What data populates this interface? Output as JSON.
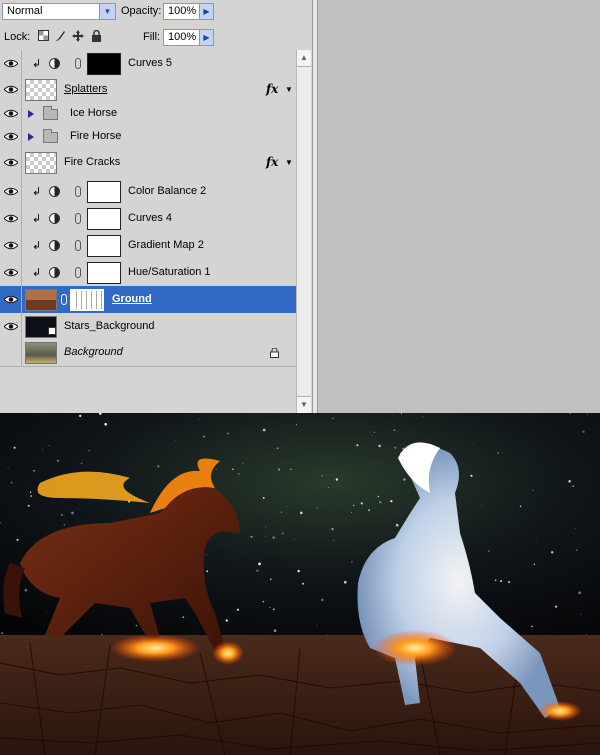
{
  "options": {
    "blend_mode": "Normal",
    "opacity_label": "Opacity:",
    "opacity_value": "100%",
    "lock_label": "Lock:",
    "fill_label": "Fill:",
    "fill_value": "100%"
  },
  "layers": [
    {
      "name": "Curves 5",
      "type": "adjustment",
      "clipped": true,
      "mask": "black",
      "visible": true
    },
    {
      "name": "Splatters",
      "type": "pixel",
      "fx": true,
      "visible": true,
      "underlined": true
    },
    {
      "name": "Ice Horse",
      "type": "group",
      "visible": true
    },
    {
      "name": "Fire Horse",
      "type": "group",
      "visible": true
    },
    {
      "name": "Fire Cracks",
      "type": "pixel",
      "fx": true,
      "visible": true
    },
    {
      "name": "Color Balance 2",
      "type": "adjustment",
      "clipped": true,
      "mask": "white",
      "visible": true
    },
    {
      "name": "Curves 4",
      "type": "adjustment",
      "clipped": true,
      "mask": "white",
      "visible": true
    },
    {
      "name": "Gradient Map 2",
      "type": "adjustment",
      "clipped": true,
      "mask": "white",
      "visible": true
    },
    {
      "name": "Hue/Saturation 1",
      "type": "adjustment",
      "clipped": true,
      "mask": "white",
      "visible": true
    },
    {
      "name": "Ground",
      "type": "pixel-mask",
      "selected": true,
      "visible": true
    },
    {
      "name": "Stars_Background",
      "type": "smart",
      "visible": true
    },
    {
      "name": "Background",
      "type": "background",
      "locked": true,
      "visible": false
    }
  ],
  "fx_glyph": "fx",
  "colors": {
    "selection": "#316ac5",
    "panel": "#d4d4d4"
  }
}
